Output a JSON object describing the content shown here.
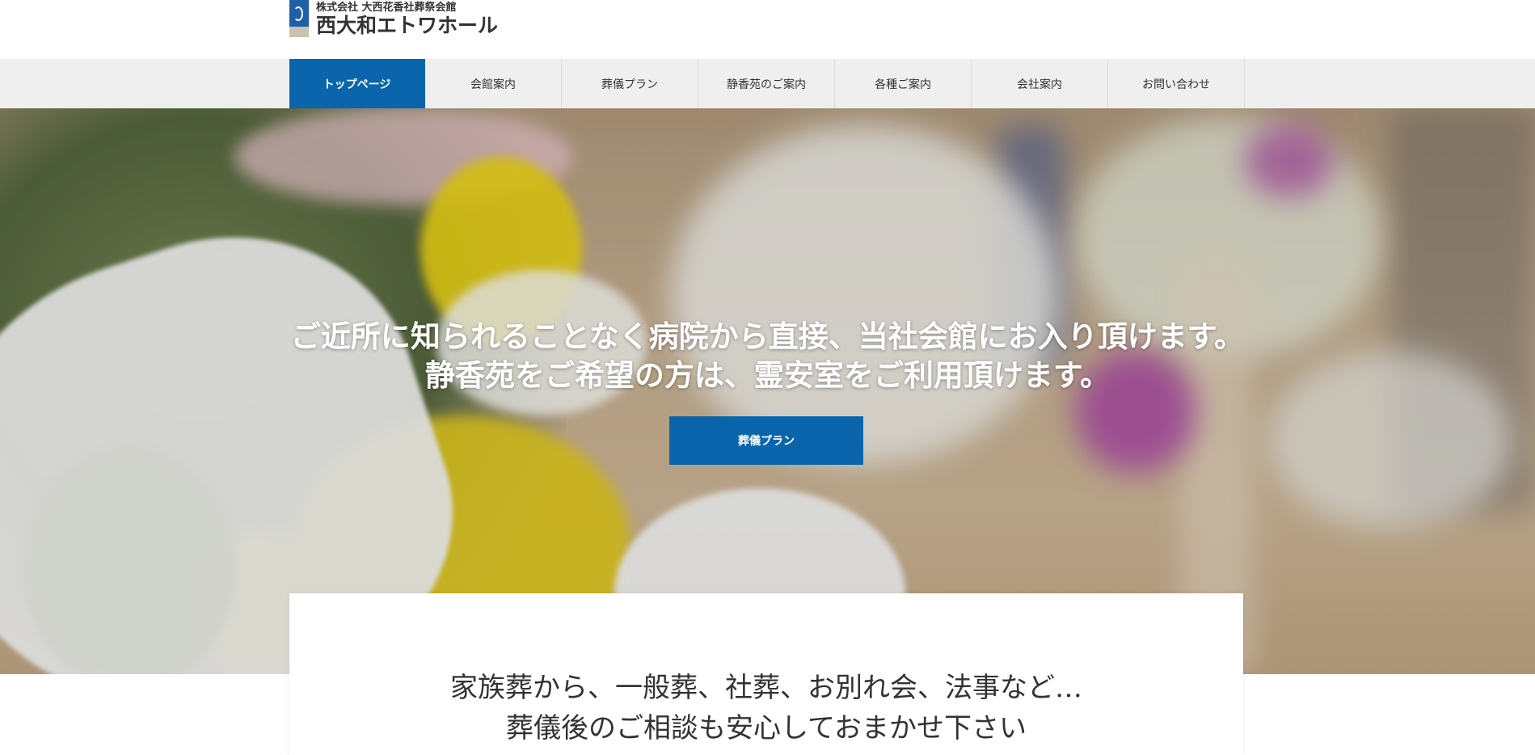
{
  "header": {
    "logo_sub": "株式会社 大西花香社葬祭会館",
    "logo_main": "西大和エトワホール",
    "logo_icon": "logo-mark-icon"
  },
  "nav": {
    "items": [
      {
        "label": "トップページ",
        "active": true
      },
      {
        "label": "会館案内"
      },
      {
        "label": "葬儀プラン"
      },
      {
        "label": "静香苑のご案内"
      },
      {
        "label": "各種ご案内"
      },
      {
        "label": "会社案内"
      },
      {
        "label": "お問い合わせ"
      }
    ]
  },
  "hero": {
    "line1": "ご近所に知られることなく病院から直接、当社会館にお入り頂けます。",
    "line2": "静香苑をご希望の方は、霊安室をご利用頂けます。",
    "button": "葬儀プラン"
  },
  "intro": {
    "line1": "家族葬から、一般葬、社葬、お別れ会、法事など…",
    "line2": "葬儀後のご相談も安心しておまかせ下さい"
  },
  "colors": {
    "accent": "#0b65ad",
    "nav_bg": "#efefef",
    "text": "#333333"
  }
}
